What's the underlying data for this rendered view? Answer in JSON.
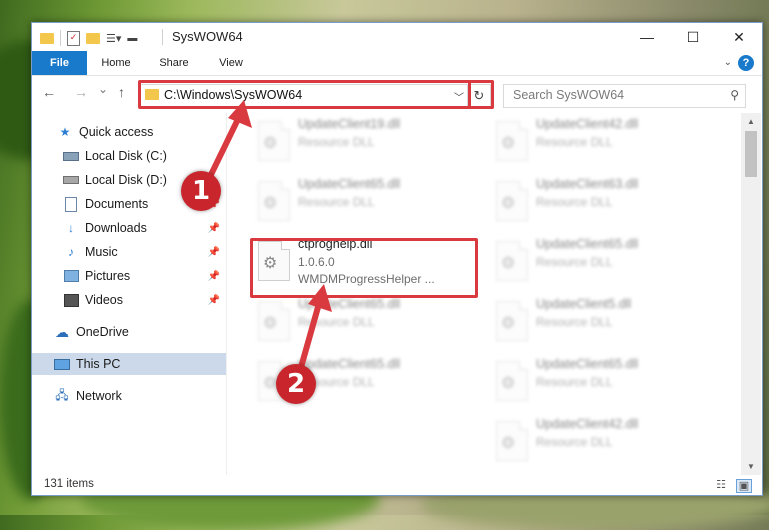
{
  "window": {
    "title": "SysWOW64",
    "controls": {
      "minimize": "—",
      "maximize": "☐",
      "close": "✕"
    }
  },
  "ribbon": {
    "tabs": [
      "File",
      "Home",
      "Share",
      "View"
    ],
    "help": "?"
  },
  "navigation": {
    "back": "←",
    "forward": "→",
    "recent": "⌄",
    "up": "↑",
    "address": "C:\\Windows\\SysWOW64",
    "refresh": "↻",
    "search_placeholder": "Search SysWOW64"
  },
  "sidebar": {
    "items": [
      {
        "label": "Quick access",
        "icon": "star-icon"
      },
      {
        "label": "Local Disk (C:)",
        "icon": "drive-icon"
      },
      {
        "label": "Local Disk (D:)",
        "icon": "drive-icon"
      },
      {
        "label": "Documents",
        "icon": "document-icon"
      },
      {
        "label": "Downloads",
        "icon": "download-icon"
      },
      {
        "label": "Music",
        "icon": "music-icon"
      },
      {
        "label": "Pictures",
        "icon": "pictures-icon"
      },
      {
        "label": "Videos",
        "icon": "video-icon"
      },
      {
        "label": "OneDrive",
        "icon": "cloud-icon"
      },
      {
        "label": "This PC",
        "icon": "computer-icon"
      },
      {
        "label": "Network",
        "icon": "network-icon"
      }
    ]
  },
  "files": {
    "left": [
      {
        "name": "UpdateClient19.dll",
        "line2": "Resource DLL",
        "line3": ""
      },
      {
        "name": "UpdateClient65.dll",
        "line2": "Resource DLL",
        "line3": ""
      },
      {
        "name": "ctproghelp.dll",
        "line2": "1.0.6.0",
        "line3": "WMDMProgressHelper ..."
      },
      {
        "name": "UpdateClient65.dll",
        "line2": "Resource DLL",
        "line3": ""
      },
      {
        "name": "UpdateClient65.dll",
        "line2": "Resource DLL",
        "line3": ""
      }
    ],
    "right": [
      {
        "name": "UpdateClient42.dll",
        "line2": "Resource DLL"
      },
      {
        "name": "UpdateClient63.dll",
        "line2": "Resource DLL"
      },
      {
        "name": "UpdateClient65.dll",
        "line2": "Resource DLL"
      },
      {
        "name": "UpdateClient5.dll",
        "line2": "Resource DLL"
      },
      {
        "name": "UpdateClient65.dll",
        "line2": "Resource DLL"
      },
      {
        "name": "UpdateClient42.dll",
        "line2": "Resource DLL"
      }
    ]
  },
  "status": {
    "count": "131 items"
  },
  "annotations": {
    "step1": "1",
    "step2": "2",
    "color": "#d93a3f"
  }
}
